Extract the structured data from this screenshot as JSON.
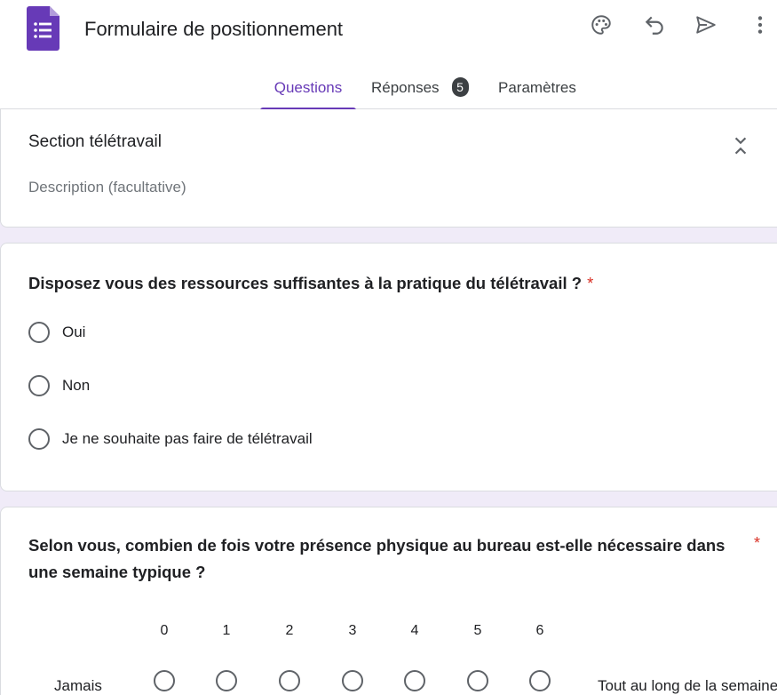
{
  "header": {
    "title": "Formulaire de positionnement",
    "icons": [
      "forms-logo",
      "palette-icon",
      "undo-icon",
      "send-icon",
      "more-vert-icon"
    ],
    "accent_color": "#673ab7"
  },
  "tabs": [
    {
      "label": "Questions",
      "active": true
    },
    {
      "label": "Réponses",
      "badge": "5"
    },
    {
      "label": "Paramètres"
    }
  ],
  "section": {
    "title": "Section télétravail",
    "description": "Description (facultative)"
  },
  "question1": {
    "title": "Disposez vous des ressources suffisantes à la pratique du télétravail ?",
    "required_mark": "*",
    "options": [
      "Oui",
      "Non",
      "Je ne souhaite pas faire de télétravail"
    ]
  },
  "question2": {
    "title": "Selon vous, combien de fois votre présence physique au bureau est-elle nécessaire dans une semaine typique ?",
    "required_mark": "*",
    "scale": [
      "0",
      "1",
      "2",
      "3",
      "4",
      "5",
      "6"
    ],
    "low_label": "Jamais",
    "high_label": "Tout au long de la semaine"
  }
}
